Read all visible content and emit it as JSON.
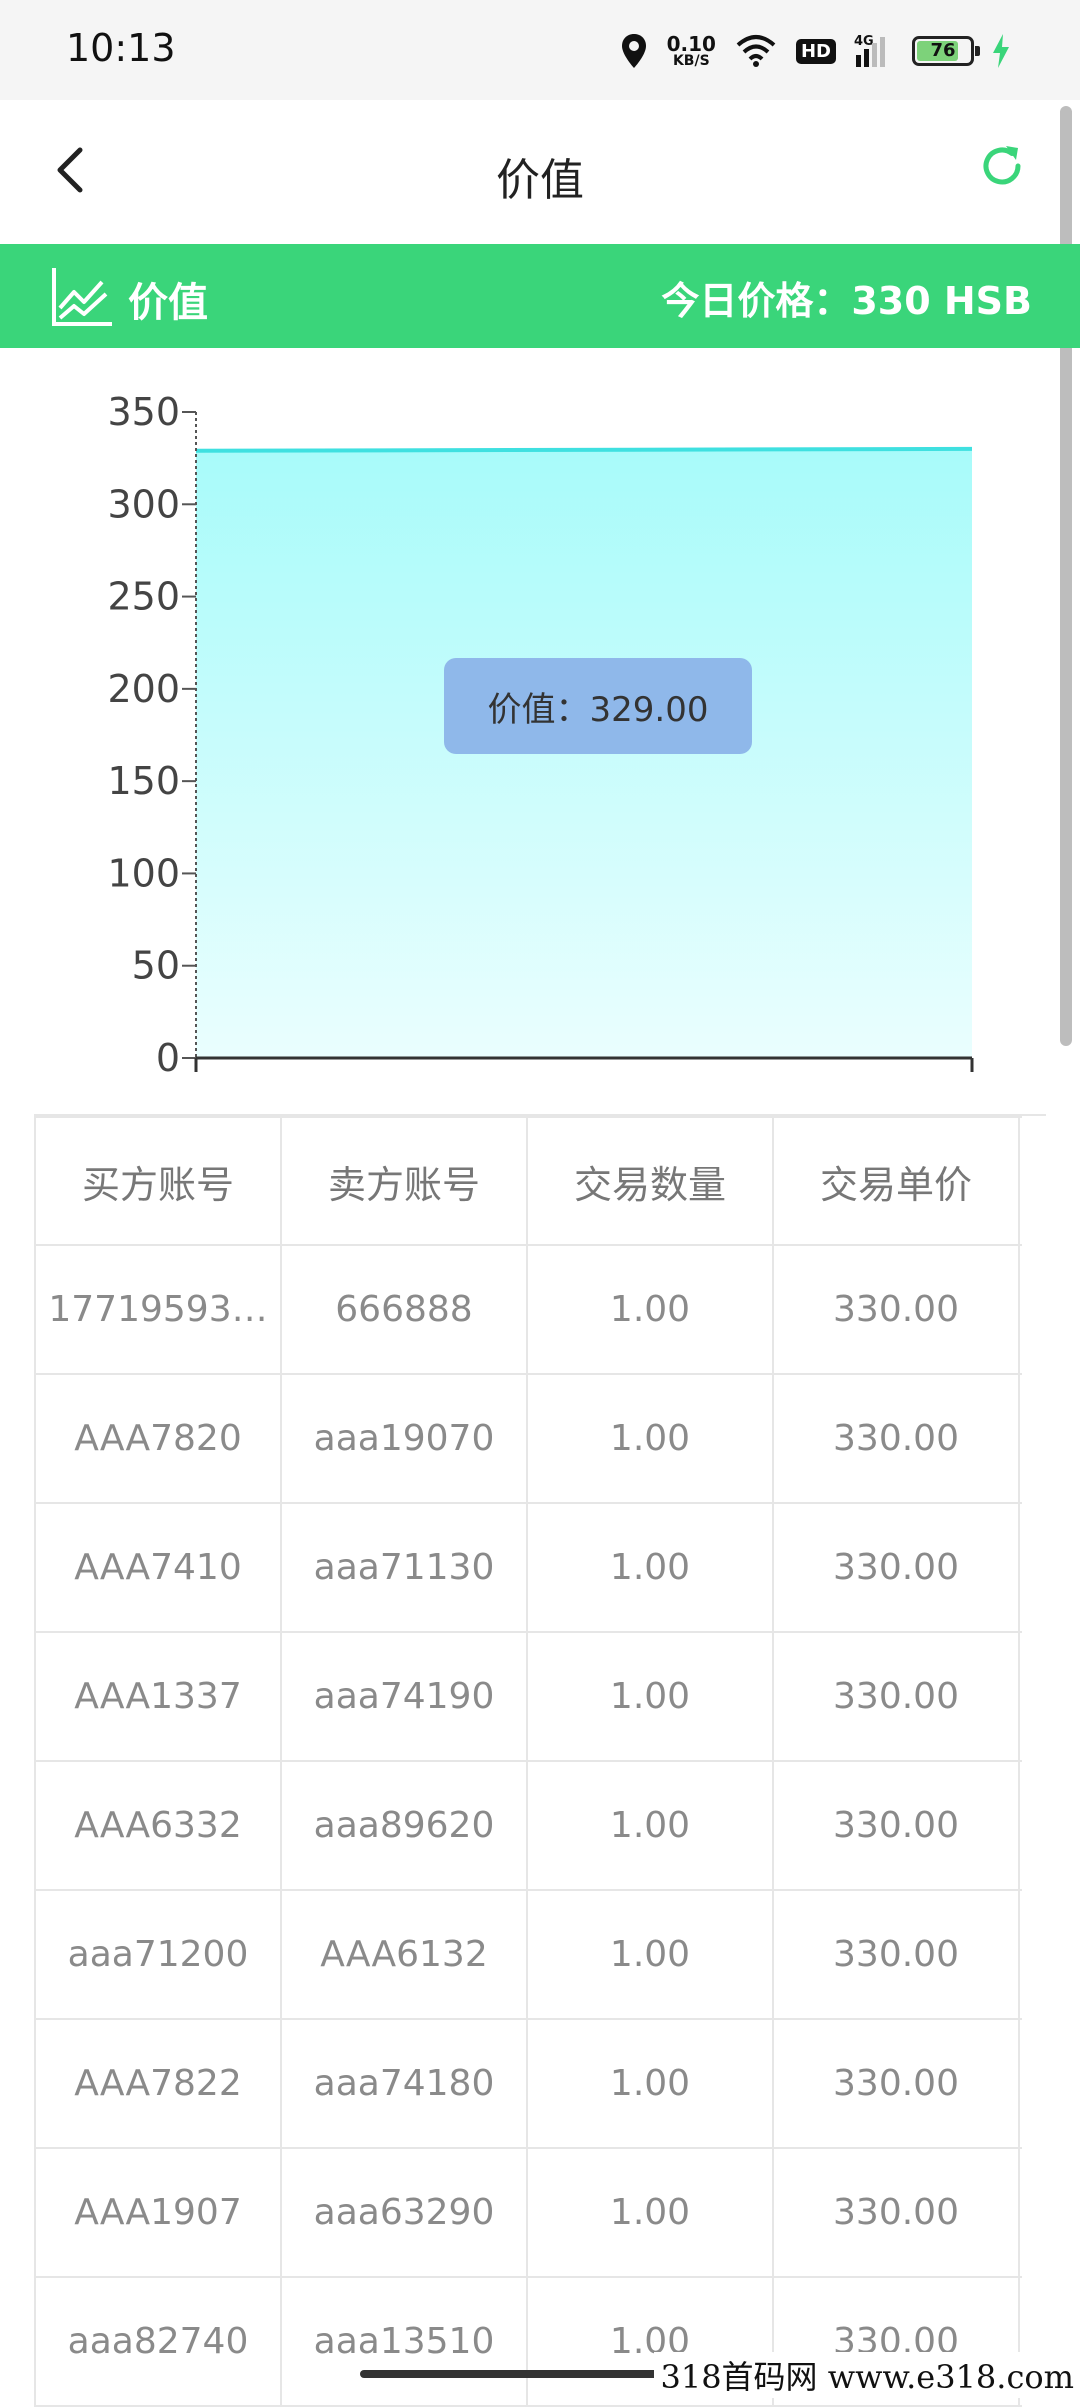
{
  "status": {
    "time": "10:13",
    "net_speed": "0.10",
    "net_unit": "KB/S",
    "hd": "HD",
    "network": "4G",
    "battery": "76"
  },
  "nav": {
    "title": "价值"
  },
  "banner": {
    "label": "价值",
    "price_text": "今日价格：330 HSB"
  },
  "chart_data": {
    "type": "area",
    "title": "",
    "xlabel": "",
    "ylabel": "",
    "ylim": [
      0,
      350
    ],
    "yticks": [
      "350",
      "300",
      "250",
      "200",
      "150",
      "100",
      "50",
      "0"
    ],
    "series": [
      {
        "values": [
          329,
          330
        ]
      }
    ],
    "line_color": "#3fe0e0",
    "fill_color": "#b4fafa",
    "tooltip": "价值：329.00"
  },
  "table": {
    "headers": [
      "买方账号",
      "卖方账号",
      "交易数量",
      "交易单价"
    ],
    "rows": [
      [
        "17719593…",
        "666888",
        "1.00",
        "330.00"
      ],
      [
        "AAA7820",
        "aaa19070",
        "1.00",
        "330.00"
      ],
      [
        "AAA7410",
        "aaa71130",
        "1.00",
        "330.00"
      ],
      [
        "AAA1337",
        "aaa74190",
        "1.00",
        "330.00"
      ],
      [
        "AAA6332",
        "aaa89620",
        "1.00",
        "330.00"
      ],
      [
        "aaa71200",
        "AAA6132",
        "1.00",
        "330.00"
      ],
      [
        "AAA7822",
        "aaa74180",
        "1.00",
        "330.00"
      ],
      [
        "AAA1907",
        "aaa63290",
        "1.00",
        "330.00"
      ],
      [
        "aaa82740",
        "aaa13510",
        "1.00",
        "330.00"
      ]
    ]
  },
  "watermark": "318首码网  www.e318.com",
  "colors": {
    "accent": "#3ad57a",
    "tooltip": "#8fb8ea"
  }
}
